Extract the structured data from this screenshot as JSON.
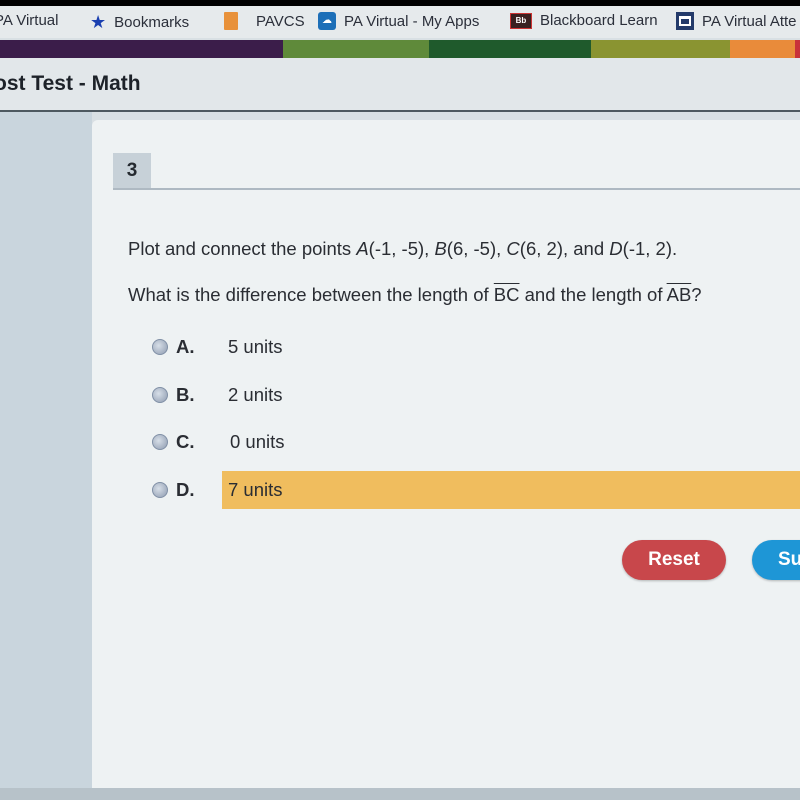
{
  "bookmarks": [
    {
      "label": "PA Virtual",
      "icon": "none"
    },
    {
      "label": "Bookmarks",
      "icon": "star-icon"
    },
    {
      "label": "PAVCS",
      "icon": "folder-icon"
    },
    {
      "label": "PA Virtual - My Apps",
      "icon": "apps-icon"
    },
    {
      "label": "Blackboard Learn",
      "icon": "blackboard-icon"
    },
    {
      "label": "PA Virtual Atte",
      "icon": "attendance-icon"
    }
  ],
  "colorbar": [
    "#3b1d4a",
    "#5f8a3a",
    "#1f5a2c",
    "#8a9431",
    "#e98b3a",
    "#c8323a"
  ],
  "header": {
    "title": "ost Test - Math"
  },
  "question": {
    "number": "3",
    "line1_prefix": "Plot and connect the points ",
    "points": [
      {
        "name": "A",
        "coords": "(-1, -5)",
        "sep": ", "
      },
      {
        "name": "B",
        "coords": "(6, -5)",
        "sep": ", "
      },
      {
        "name": "C",
        "coords": "(6, 2)",
        "sep": ", and "
      },
      {
        "name": "D",
        "coords": "(-1, 2)",
        "sep": "."
      }
    ],
    "line2_a": "What is the difference between the length of ",
    "seg1": "BC",
    "line2_b": " and the length of ",
    "seg2": "AB",
    "line2_c": "?"
  },
  "choices": [
    {
      "letter": "A.",
      "text": "5 units",
      "selected": false
    },
    {
      "letter": "B.",
      "text": "2 units",
      "selected": false
    },
    {
      "letter": "C.",
      "text": "0 units",
      "selected": false
    },
    {
      "letter": "D.",
      "text": "7 units",
      "selected": true
    }
  ],
  "buttons": {
    "reset": "Reset",
    "submit": "Su"
  },
  "colors": {
    "selected_highlight": "#f0bd5e",
    "reset": "#c8474b",
    "submit": "#1e96d6"
  }
}
